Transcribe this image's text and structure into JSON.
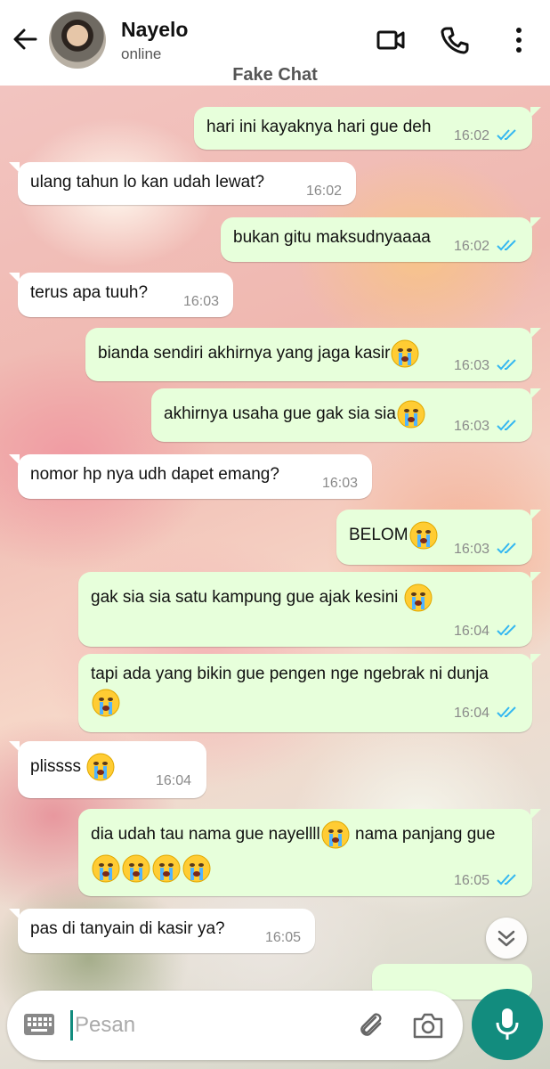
{
  "header": {
    "contact_name": "Nayelo",
    "status": "online",
    "app_title": "Fake Chat",
    "icons": [
      "back-arrow-icon",
      "video-call-icon",
      "voice-call-icon",
      "more-options-icon"
    ]
  },
  "messages": [
    {
      "direction": "out",
      "text": "hari ini kayaknya hari gue deh",
      "time": "16:02",
      "read": true
    },
    {
      "direction": "in",
      "text": "ulang tahun lo kan udah lewat?",
      "time": "16:02"
    },
    {
      "direction": "out",
      "text": "bukan gitu maksudnyaaaa",
      "time": "16:02",
      "read": true
    },
    {
      "direction": "in",
      "text": "terus apa tuuh?",
      "time": "16:03"
    },
    {
      "direction": "out",
      "text": "bianda sendiri akhirnya yang jaga kasir",
      "emoji_after": 1,
      "time": "16:03",
      "read": true
    },
    {
      "direction": "out",
      "text": "akhirnya usaha gue gak sia sia",
      "emoji_after": 1,
      "time": "16:03",
      "read": true
    },
    {
      "direction": "in",
      "text": "nomor hp nya udh dapet emang?",
      "time": "16:03"
    },
    {
      "direction": "out",
      "text": "BELOM",
      "emoji_after": 1,
      "time": "16:03",
      "read": true
    },
    {
      "direction": "out",
      "text": "gak sia sia satu kampung gue ajak kesini",
      "emoji_after": 1,
      "time": "16:04",
      "read": true
    },
    {
      "direction": "out",
      "text": "tapi ada yang bikin gue pengen nge ngebrak ni dunja",
      "emoji_line2": 1,
      "time": "16:04",
      "read": true
    },
    {
      "direction": "in",
      "text": "plissss",
      "emoji_after": 1,
      "time": "16:04"
    },
    {
      "direction": "out",
      "text_part1": "dia udah tau nama gue nayellll",
      "text_part2": "nama panjang gue",
      "emoji_line2": 4,
      "time": "16:05",
      "read": true
    },
    {
      "direction": "in",
      "text": "pas di tanyain di kasir ya?",
      "time": "16:05"
    }
  ],
  "emoji_name": "loudly-crying-face",
  "input": {
    "placeholder": "Pesan",
    "value": ""
  },
  "colors": {
    "outgoing_bubble": "#e7ffdb",
    "incoming_bubble": "#ffffff",
    "accent": "#128c7e",
    "read_ticks": "#34b7f1"
  }
}
